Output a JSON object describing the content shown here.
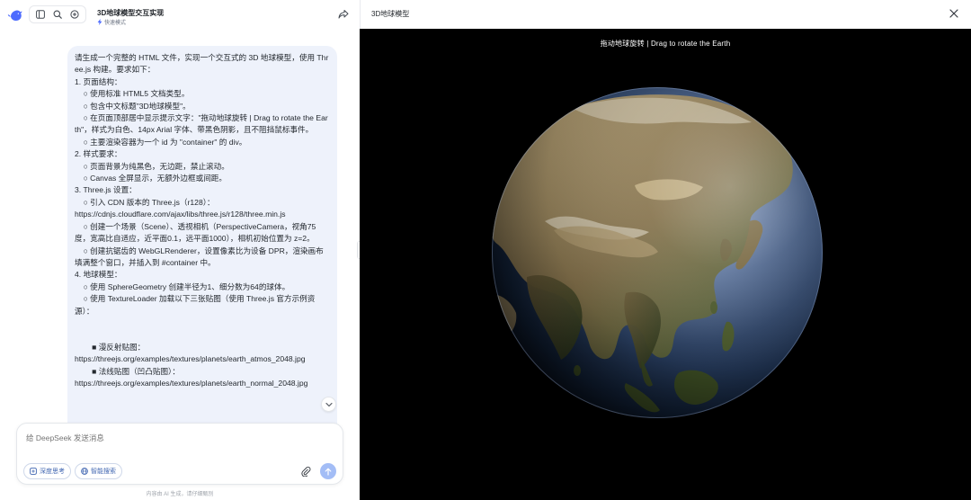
{
  "sidebar_toolbar": {
    "icons": [
      "panel-toggle-icon",
      "search-icon",
      "new-chat-icon"
    ]
  },
  "chat": {
    "title": "3D地球模型交互实现",
    "mode": "快速模式",
    "message": "请生成一个完整的 HTML 文件，实现一个交互式的 3D 地球模型，使用 Three.js 构建。要求如下：\n1. 页面结构：\n    ○ 使用标准 HTML5 文档类型。\n    ○ 包含中文标题\"3D地球模型\"。\n    ○ 在页面顶部居中显示提示文字：\"拖动地球旋转 | Drag to rotate the Earth\"，样式为白色、14px Arial 字体、带黑色阴影，且不阻挡鼠标事件。\n    ○ 主要渲染容器为一个 id 为 \"container\" 的 div。\n2. 样式要求：\n    ○ 页面背景为纯黑色，无边距，禁止滚动。\n    ○ Canvas 全屏显示，无额外边框或间距。\n3. Three.js 设置：\n    ○ 引入 CDN 版本的 Three.js（r128）：\nhttps://cdnjs.cloudflare.com/ajax/libs/three.js/r128/three.min.js\n    ○ 创建一个场景（Scene）、透视相机（PerspectiveCamera，视角75度，宽高比自适应，近平面0.1，远平面1000），相机初始位置为 z=2。\n    ○ 创建抗锯齿的 WebGLRenderer，设置像素比为设备 DPR，渲染画布填满整个窗口，并插入到 #container 中。\n4. 地球模型：\n    ○ 使用 SphereGeometry 创建半径为1、细分数为64的球体。\n    ○ 使用 TextureLoader 加载以下三张贴图（使用 Three.js 官方示例资源）：\n\n\n        ■ 漫反射贴图：\nhttps://threejs.org/examples/textures/planets/earth_atmos_2048.jpg\n        ■ 法线贴图（凹凸贴图）：\nhttps://threejs.org/examples/textures/planets/earth_normal_2048.jpg"
  },
  "input": {
    "placeholder": "给 DeepSeek 发送消息",
    "deep_think_label": "深度思考",
    "web_search_label": "智能搜索"
  },
  "disclaimer": "内容由 AI 生成，请仔细甄别",
  "preview": {
    "title": "3D地球模型",
    "hint": "拖动地球旋转 | Drag to rotate the Earth"
  },
  "colors": {
    "accent": "#4d6bfe",
    "message_bg": "#eef2fb",
    "send_disabled": "#a3bdf6",
    "stage_bg": "#000000"
  }
}
